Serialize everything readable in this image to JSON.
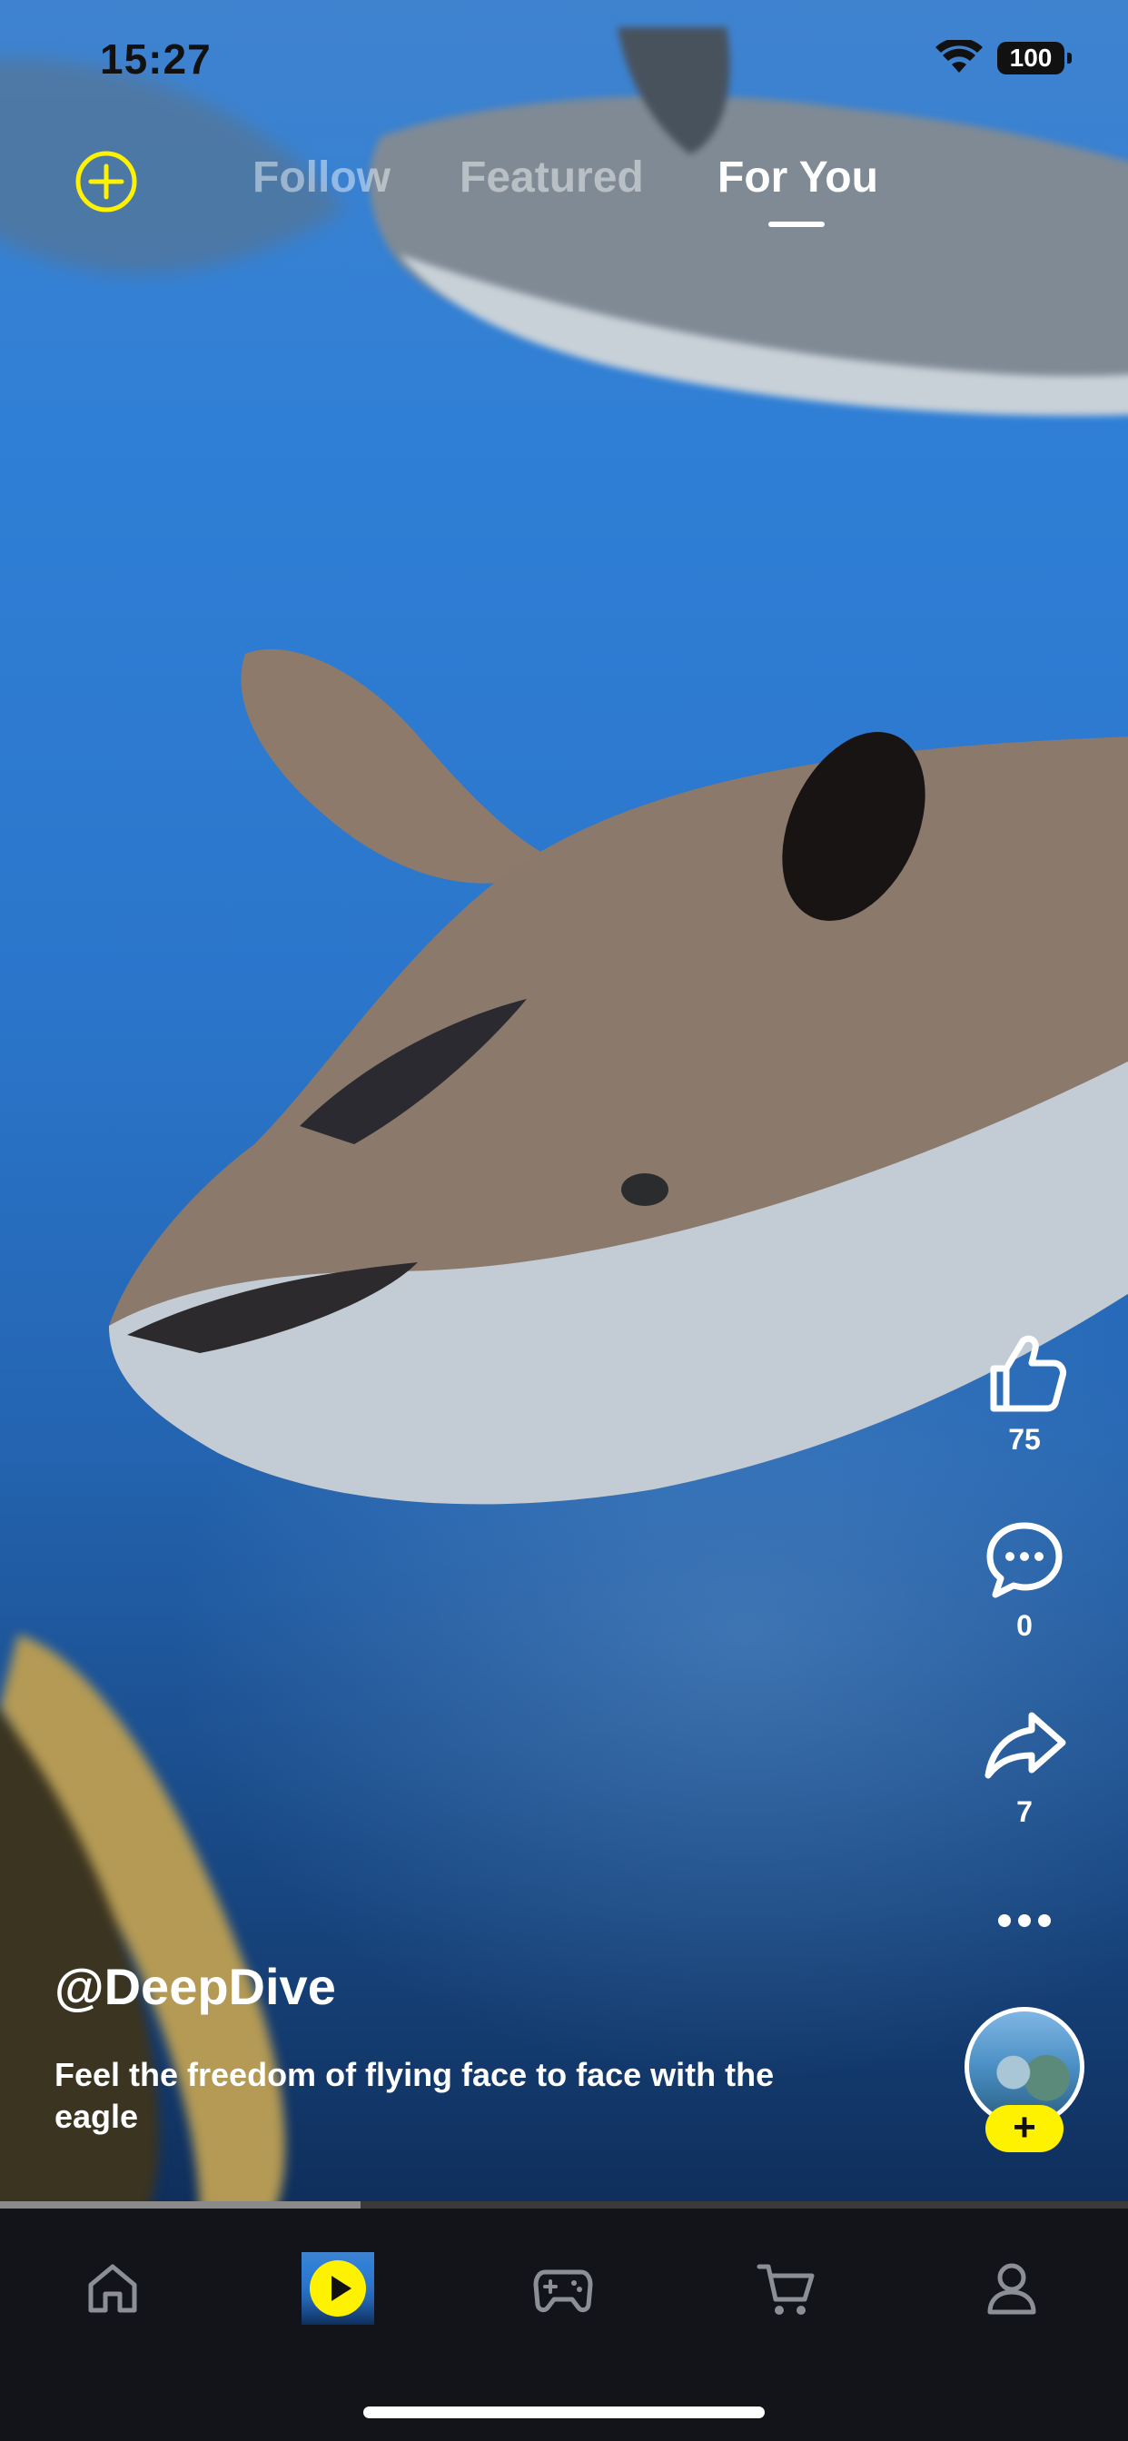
{
  "status_bar": {
    "time": "15:27",
    "battery": "100"
  },
  "top_nav": {
    "tabs": [
      {
        "label": "Follow",
        "active": false
      },
      {
        "label": "Featured",
        "active": false
      },
      {
        "label": "For You",
        "active": true
      }
    ],
    "add_icon": "plus-circle-icon"
  },
  "post": {
    "username": "@DeepDive",
    "caption": "Feel the freedom of flying face to face with the eagle",
    "likes": "75",
    "comments": "0",
    "shares": "7",
    "playback_progress": 0.32
  },
  "bottom_nav": {
    "items": [
      {
        "icon": "home-icon",
        "active": false
      },
      {
        "icon": "play-icon",
        "active": true
      },
      {
        "icon": "gamepad-icon",
        "active": false
      },
      {
        "icon": "cart-icon",
        "active": false
      },
      {
        "icon": "profile-icon",
        "active": false
      }
    ]
  },
  "colors": {
    "accent": "#fff200",
    "tabbar_bg": "#12141a"
  }
}
